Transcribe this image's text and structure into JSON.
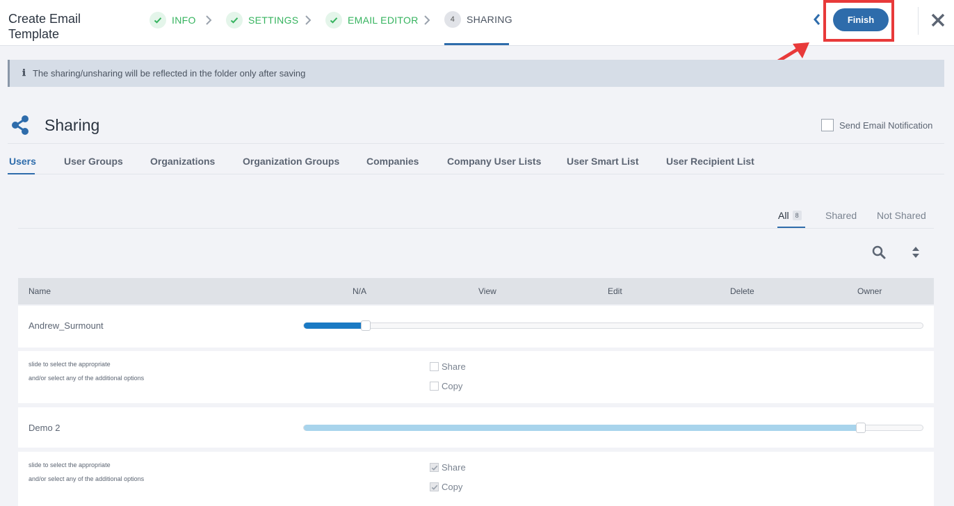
{
  "header": {
    "title": "Create Email Template",
    "steps": [
      {
        "label": "INFO",
        "state": "done"
      },
      {
        "label": "SETTINGS",
        "state": "done"
      },
      {
        "label": "EMAIL EDITOR",
        "state": "done"
      },
      {
        "label": "SHARING",
        "state": "active",
        "number": "4"
      }
    ],
    "finish_label": "Finish"
  },
  "banner": {
    "text": "The sharing/unsharing will be reflected in the folder only after saving"
  },
  "sharing": {
    "title": "Sharing",
    "notify_label": "Send Email Notification",
    "notify_checked": false
  },
  "tabs": [
    "Users",
    "User Groups",
    "Organizations",
    "Organization Groups",
    "Companies",
    "Company User Lists",
    "User Smart List",
    "User Recipient List"
  ],
  "filters": {
    "all": "All",
    "all_count": "8",
    "shared": "Shared",
    "not_shared": "Not Shared"
  },
  "table": {
    "columns": [
      "Name",
      "N/A",
      "View",
      "Edit",
      "Delete",
      "Owner"
    ],
    "help_line1": "slide to select the appropriate",
    "help_line2": "and/or select any of the additional options",
    "rows": [
      {
        "name": "Andrew_Surmount",
        "level": 0.1,
        "share": "Share",
        "copy": "Copy",
        "share_checked": false,
        "copy_checked": false
      },
      {
        "name": "Demo 2",
        "level": 0.9,
        "share": "Share",
        "copy": "Copy",
        "share_checked": true,
        "copy_checked": true
      }
    ]
  },
  "colors": {
    "accent": "#2e6cab",
    "done_green": "#35b35e",
    "highlight_red": "#e83a3a",
    "slider_dark": "#1a7ac4",
    "slider_light": "#a8d4ec"
  }
}
